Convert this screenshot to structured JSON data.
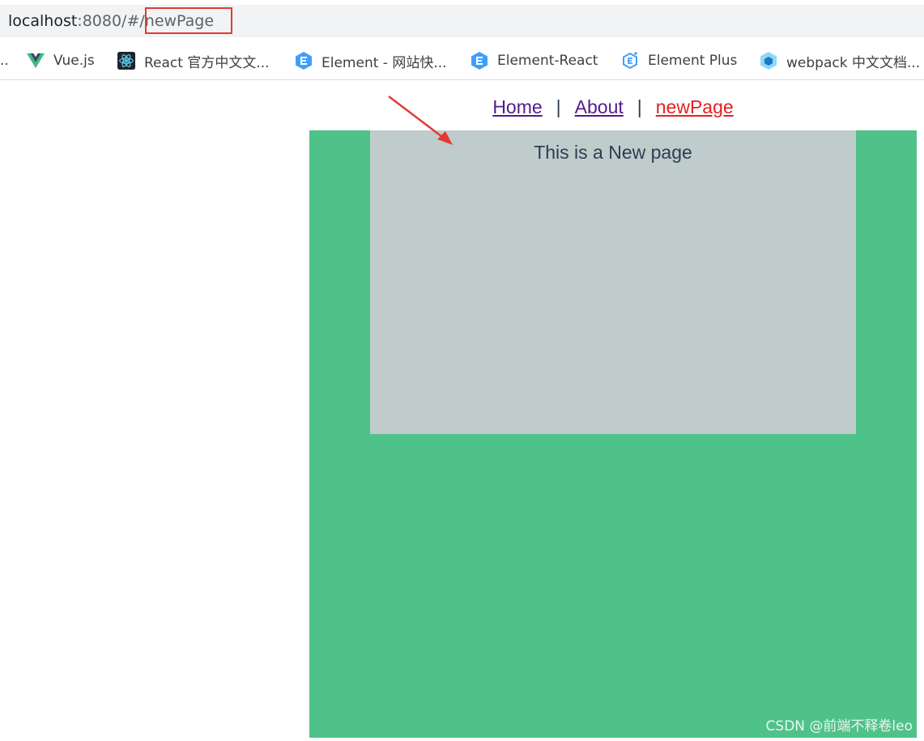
{
  "browser": {
    "url_host": "localhost",
    "url_rest": ":8080/#/newPage"
  },
  "bookmarks": {
    "leading_ellipsis": "..",
    "items": [
      {
        "label": "Vue.js",
        "icon": "vue-logo-icon"
      },
      {
        "label": "React 官方中文文...",
        "icon": "react-logo-icon"
      },
      {
        "label": "Element - 网站快...",
        "icon": "element-logo-icon"
      },
      {
        "label": "Element-React",
        "icon": "element-logo-icon"
      },
      {
        "label": "Element Plus",
        "icon": "element-plus-logo-icon"
      },
      {
        "label": "webpack 中文文档...",
        "icon": "webpack-logo-icon"
      }
    ]
  },
  "nav": {
    "links": [
      {
        "label": "Home"
      },
      {
        "label": "About"
      },
      {
        "label": "newPage"
      }
    ],
    "separator": "|"
  },
  "page": {
    "text": "This is a New page"
  },
  "watermark": "CSDN @前端不释卷leo",
  "colors": {
    "green_background": "#4fc28a",
    "gray_box": "#c0cbcc",
    "active_link": "#e52020",
    "visited_link": "#551a8b",
    "annotation_red": "#e53935"
  }
}
